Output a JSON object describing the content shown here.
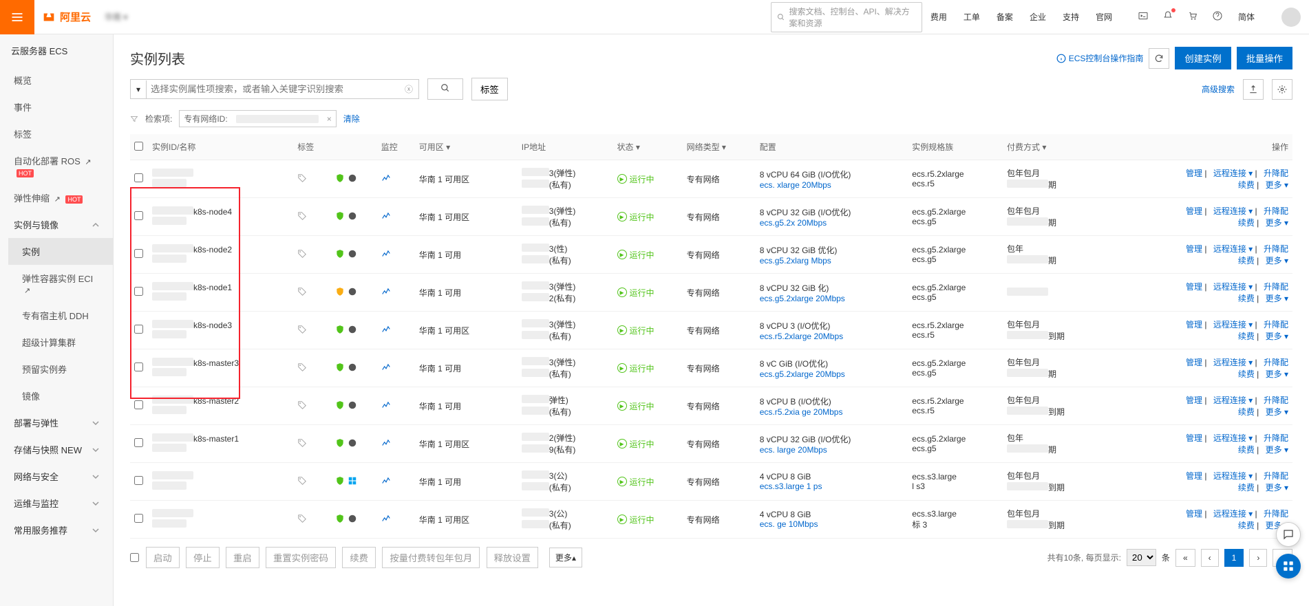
{
  "brand": "阿里云",
  "top_search_placeholder": "搜索文档、控制台、API、解决方案和资源",
  "top_nav": [
    "费用",
    "工单",
    "备案",
    "企业",
    "支持",
    "官网"
  ],
  "top_lang": "简体",
  "sidebar": {
    "title": "云服务器 ECS",
    "items": [
      {
        "label": "概览"
      },
      {
        "label": "事件"
      },
      {
        "label": "标签"
      },
      {
        "label": "自动化部署 ROS",
        "ext": true,
        "hot": true
      },
      {
        "label": "弹性伸缩",
        "ext": true,
        "hot": true
      }
    ],
    "group_inst": {
      "label": "实例与镜像",
      "sub": [
        {
          "label": "实例",
          "active": true
        },
        {
          "label": "弹性容器实例 ECI",
          "ext": true
        },
        {
          "label": "专有宿主机 DDH"
        },
        {
          "label": "超级计算集群"
        },
        {
          "label": "预留实例券"
        },
        {
          "label": "镜像"
        }
      ]
    },
    "groups2": [
      {
        "label": "部署与弹性"
      },
      {
        "label": "存储与快照",
        "new": true
      },
      {
        "label": "网络与安全"
      },
      {
        "label": "运维与监控"
      },
      {
        "label": "常用服务推荐"
      }
    ]
  },
  "page": {
    "title": "实例列表",
    "guide": "ECS控制台操作指南",
    "create": "创建实例",
    "bulk": "批量操作",
    "search_placeholder": "选择实例属性项搜索，或者输入关键字识别搜索",
    "tag_btn": "标签",
    "adv": "高级搜索",
    "filter_label": "检索项:",
    "filter_tag": "专有网络ID:",
    "clear": "清除"
  },
  "table": {
    "headers": [
      "实例ID/名称",
      "标签",
      "",
      "监控",
      "可用区",
      "",
      "IP地址",
      "状态",
      "网络类型",
      "配置",
      "实例规格族",
      "付费方式",
      "",
      "操作"
    ]
  },
  "rows": [
    {
      "name": "",
      "sub": "",
      "zone": "华南 1 可用区",
      "ip1": "3(弹性)",
      "ip2": "(私有)",
      "status": "运行中",
      "net": "专有网络",
      "cfg1": "8 vCPU 64 GiB (I/O优化)",
      "cfg2": "ecs.  xlarge  20Mbps",
      "spec1": "ecs.r5.2xlarge",
      "spec2": "ecs.r5",
      "pay": "包年包月",
      "exp": "期",
      "shield": "g",
      "os": "w"
    },
    {
      "name": "k8s-node4",
      "sub": "",
      "zone": "华南 1 可用区",
      "ip1": "3(弹性)",
      "ip2": "(私有)",
      "status": "运行中",
      "net": "专有网络",
      "cfg1": "8 vCPU 32 GiB (I/O优化)",
      "cfg2": "ecs.g5.2x     20Mbps",
      "spec1": "ecs.g5.2xlarge",
      "spec2": "ecs.g5",
      "pay": "包年包月",
      "exp": "期",
      "shield": "g",
      "os": "w"
    },
    {
      "name": "k8s-node2",
      "sub": "",
      "zone": "华南 1 可用",
      "ip1": "3(性)",
      "ip2": "(私有)",
      "status": "运行中",
      "net": "专有网络",
      "cfg1": "8 vCPU 32 GiB   优化)",
      "cfg2": "ecs.g5.2xlarg  Mbps",
      "spec1": "ecs.g5.2xlarge",
      "spec2": "ecs.g5",
      "pay": "包年  ",
      "exp": "期",
      "shield": "g",
      "os": "w"
    },
    {
      "name": "k8s-node1",
      "sub": "",
      "zone": "华南 1 可用",
      "ip1": "3(弹性)",
      "ip2": "2(私有)",
      "status": "运行中",
      "net": "专有网络",
      "cfg1": "8 vCPU 32 GiB    化)",
      "cfg2": "ecs.g5.2xlarge  20Mbps",
      "spec1": "ecs.g5.2xlarge",
      "spec2": "ecs.g5",
      "pay": "",
      "exp": "",
      "shield": "y",
      "os": "w"
    },
    {
      "name": "k8s-node3",
      "sub": "",
      "zone": "华南 1 可用区",
      "ip1": "3(弹性)",
      "ip2": "(私有)",
      "status": "运行中",
      "net": "专有网络",
      "cfg1": "8 vCPU    3 (I/O优化)",
      "cfg2": "ecs.r5.2xlarge  20Mbps",
      "spec1": "ecs.r5.2xlarge",
      "spec2": "ecs.r5",
      "pay": "包年包月",
      "exp": "到期",
      "shield": "g",
      "os": "w"
    },
    {
      "name": "k8s-master3",
      "sub": "",
      "zone": "华南 1 可用",
      "ip1": "3(弹性)",
      "ip2": "(私有)",
      "status": "运行中",
      "net": "专有网络",
      "cfg1": "8 vC       GiB (I/O优化)",
      "cfg2": "ecs.g5.2xlarge  20Mbps",
      "spec1": "ecs.g5.2xlarge",
      "spec2": "ecs.g5",
      "pay": "包年包月",
      "exp": "期",
      "shield": "g",
      "os": "w"
    },
    {
      "name": "k8s-master2",
      "sub": "",
      "zone": "华南 1 可用",
      "ip1": "弹性)",
      "ip2": "(私有)",
      "status": "运行中",
      "net": "专有网络",
      "cfg1": "8 vCPU      B (I/O优化)",
      "cfg2": "ecs.r5.2xia ge  20Mbps",
      "spec1": "ecs.r5.2xlarge",
      "spec2": "ecs.r5",
      "pay": "包年包月",
      "exp": "到期",
      "shield": "g",
      "os": "w"
    },
    {
      "name": "k8s-master1",
      "sub": "",
      "zone": "华南 1 可用区",
      "ip1": "2(弹性)",
      "ip2": "9(私有)",
      "status": "运行中",
      "net": "专有网络",
      "cfg1": "8 vCPU 32 GiB (I/O优化)",
      "cfg2": "ecs.    large  20Mbps",
      "spec1": "ecs.g5.2xlarge",
      "spec2": "ecs.g5",
      "pay": "包年 ",
      "exp": "期",
      "shield": "g",
      "os": "w"
    },
    {
      "name": "",
      "sub": "",
      "zone": "华南 1 可用",
      "ip1": "3(公)",
      "ip2": "(私有)",
      "status": "运行中",
      "net": "专有网络",
      "cfg1": "4 vCPU 8 GiB",
      "cfg2": "ecs.s3.large  1   ps",
      "spec1": "ecs.s3.large",
      "spec2": "    l s3",
      "pay": "包年包月",
      "exp": "到期",
      "shield": "g",
      "os": "win"
    },
    {
      "name": "",
      "sub": "",
      "zone": "华南 1 可用区",
      "ip1": "3(公)",
      "ip2": "(私有)",
      "status": "运行中",
      "net": "专有网络",
      "cfg1": "4 vCPU 8 GiB",
      "cfg2": "ecs.   ge  10Mbps",
      "spec1": "ecs.s3.large",
      "spec2": "标     3",
      "pay": "包年包月",
      "exp": "到期",
      "shield": "g",
      "os": "w"
    }
  ],
  "ops": {
    "manage": "管理",
    "remote": "远程连接",
    "change": "升降配",
    "renew": "续费",
    "more": "更多"
  },
  "bulk": {
    "start": "启动",
    "stop": "停止",
    "restart": "重启",
    "resetpw": "重置实例密码",
    "renew": "续费",
    "convert": "按量付费转包年包月",
    "release": "释放设置",
    "more": "更多"
  },
  "pager": {
    "info": "共有10条, 每页显示:",
    "unit": "条",
    "size": "20"
  }
}
